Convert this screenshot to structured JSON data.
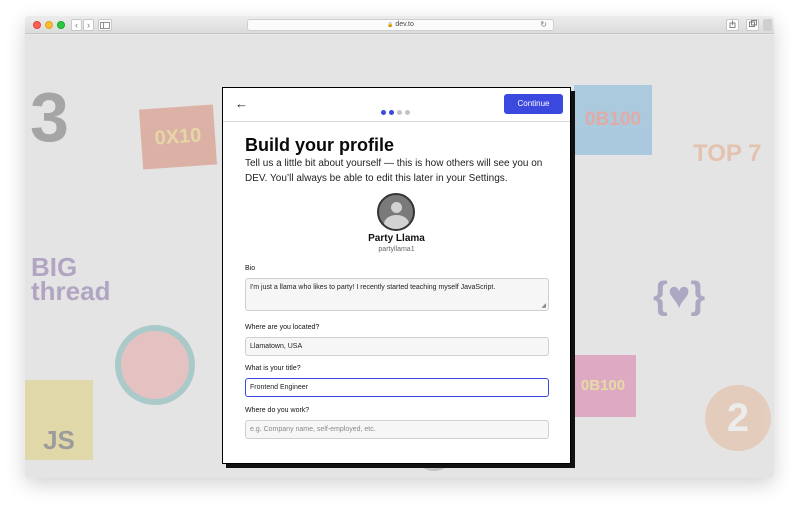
{
  "browser": {
    "address": "dev.to",
    "lock_glyph": "🔒",
    "nav_back_glyph": "‹",
    "nav_fwd_glyph": "›",
    "reload_glyph": "↻"
  },
  "modal": {
    "back_glyph": "←",
    "continue_label": "Continue",
    "progress": {
      "current": 2,
      "total": 4
    },
    "title": "Build your profile",
    "subtitle": "Tell us a little bit about yourself — this is how others will see you on DEV. You’ll always be able to edit this later in your Settings.",
    "user": {
      "name": "Party Llama",
      "handle": "partyllama1"
    },
    "fields": {
      "bio": {
        "label": "Bio",
        "value": "I'm just a llama who likes to party! I recently started teaching myself JavaScript."
      },
      "location": {
        "label": "Where are you located?",
        "value": "Llamatown, USA"
      },
      "job_title": {
        "label": "What is your title?",
        "value": "Frontend Engineer"
      },
      "work": {
        "label": "Where do you work?",
        "placeholder": "e.g. Company name, self-employed, etc."
      }
    }
  },
  "background_stickers": [
    "3",
    "0X10",
    "BIG thread",
    "JS",
    "0B100",
    "TOP 7",
    "{♥}",
    "2"
  ],
  "colors": {
    "accent": "#3b49df"
  }
}
